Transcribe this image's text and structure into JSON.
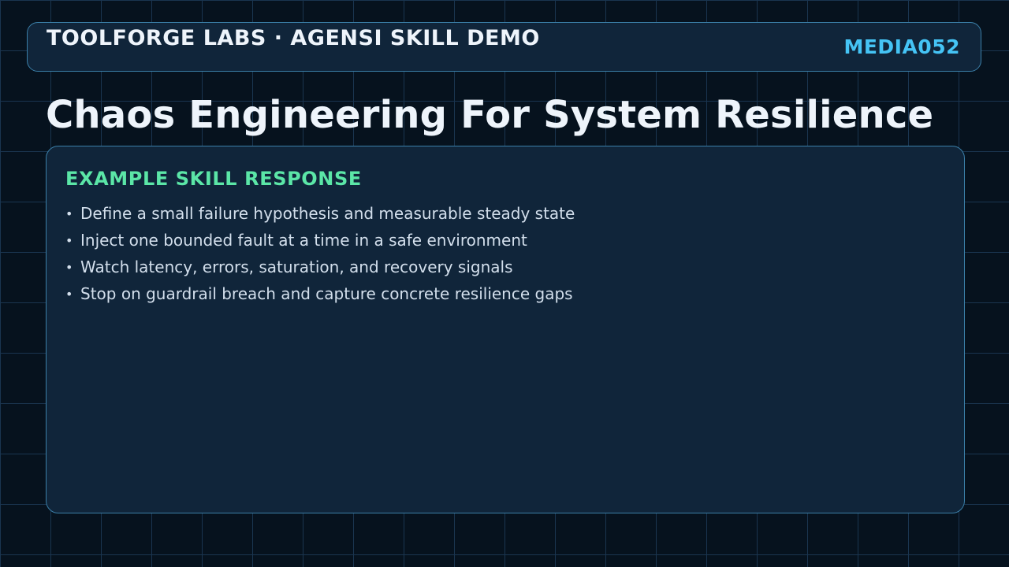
{
  "header": {
    "brand": "TOOLFORGE LABS · AGENSI SKILL DEMO",
    "media_id": "MEDIA052"
  },
  "page": {
    "title": "Chaos Engineering For System Resilience"
  },
  "card": {
    "heading": "EXAMPLE SKILL RESPONSE",
    "bullet_glyph": "•",
    "bullets": [
      "Define a small failure hypothesis and measurable steady state",
      "Inject one bounded fault at a time in a safe environment",
      "Watch latency, errors, saturation, and recovery signals",
      "Stop on guardrail breach and capture concrete resilience gaps"
    ]
  },
  "colors": {
    "background": "#06121e",
    "grid": "#1a3550",
    "panel": "#10253a",
    "panel_border": "#3b7fa8",
    "title_text": "#eef4fb",
    "accent_blue": "#45c4f5",
    "accent_green": "#5be6a7",
    "body_text": "#d3dfec"
  }
}
